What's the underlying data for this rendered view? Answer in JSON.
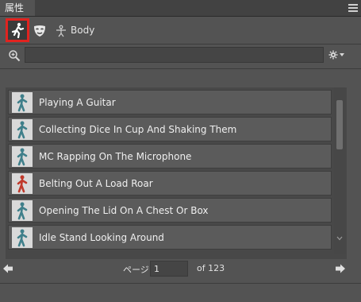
{
  "panel": {
    "title": "属性"
  },
  "toolbar": {
    "body_label": "Body"
  },
  "search": {
    "value": "",
    "placeholder": ""
  },
  "list": {
    "items": [
      {
        "label": "Playing A Guitar",
        "thumb_color": "#3f7f8a"
      },
      {
        "label": "Collecting Dice In Cup And Shaking Them",
        "thumb_color": "#3f7f8a"
      },
      {
        "label": "MC Rapping On The Microphone",
        "thumb_color": "#3f7f8a"
      },
      {
        "label": "Belting Out A Load Roar",
        "thumb_color": "#c0392b"
      },
      {
        "label": "Opening The Lid On A Chest Or Box",
        "thumb_color": "#3f7f8a"
      },
      {
        "label": "Idle Stand Looking Around",
        "thumb_color": "#3f7f8a"
      }
    ]
  },
  "pager": {
    "label": "ページ",
    "current": "1",
    "total": "of 123"
  },
  "footer": {
    "text": ""
  },
  "colors": {
    "accent": "#e1231f",
    "panel_bg": "#535353",
    "item_bg": "#5b5b5b"
  }
}
